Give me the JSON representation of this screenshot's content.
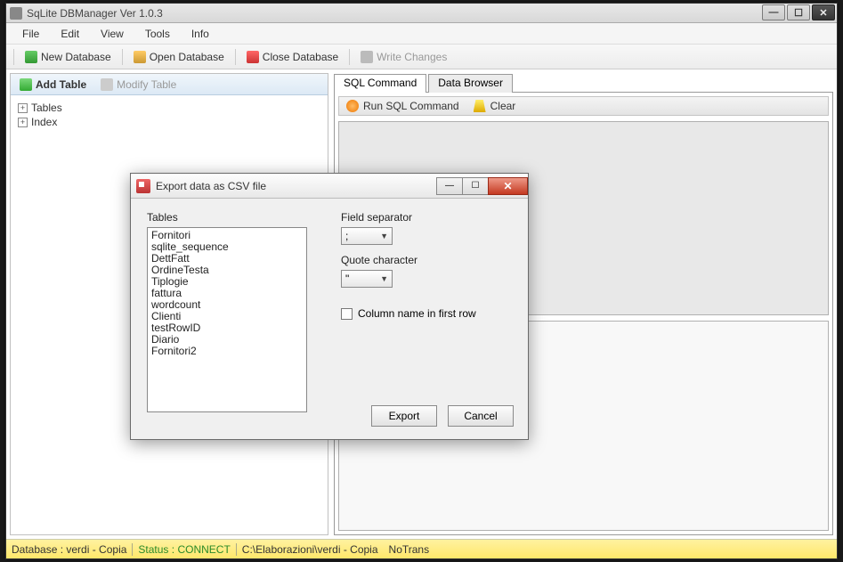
{
  "window": {
    "title": "SqLite DBManager Ver 1.0.3"
  },
  "menubar": [
    "File",
    "Edit",
    "View",
    "Tools",
    "Info"
  ],
  "toolbar": {
    "new_db": "New Database",
    "open_db": "Open Database",
    "close_db": "Close Database",
    "write_changes": "Write Changes"
  },
  "left_panel": {
    "add_table": "Add Table",
    "modify_table": "Modify Table",
    "tree": {
      "tables": "Tables",
      "index": "Index"
    }
  },
  "right_panel": {
    "tabs": {
      "sql": "SQL Command",
      "browser": "Data Browser"
    },
    "run_sql": "Run SQL Command",
    "clear": "Clear"
  },
  "dialog": {
    "title": "Export data as CSV file",
    "tables_label": "Tables",
    "tables": [
      "Fornitori",
      "sqlite_sequence",
      "DettFatt",
      "OrdineTesta",
      "Tiplogie",
      "fattura",
      "wordcount",
      "Clienti",
      "testRowID",
      "Diario",
      "Fornitori2"
    ],
    "field_sep_label": "Field separator",
    "field_sep_value": ";",
    "quote_label": "Quote character",
    "quote_value": "\"",
    "colname_label": "Column name in first row",
    "export": "Export",
    "cancel": "Cancel"
  },
  "status": {
    "db_label": "Database : ",
    "db_value": "verdi - Copia",
    "status_label": "Status : ",
    "status_value": "CONNECT",
    "path": "C:\\Elaborazioni\\verdi - Copia",
    "trans": "NoTrans"
  }
}
